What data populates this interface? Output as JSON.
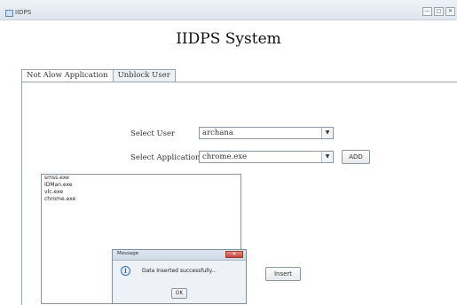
{
  "window": {
    "title": "IIDPS",
    "controls": [
      "—",
      "□",
      "✕"
    ]
  },
  "header": {
    "title": "IIDPS System"
  },
  "tabs": [
    {
      "label": "Not Alow Application",
      "active": true
    },
    {
      "label": "Unblock User",
      "active": false
    }
  ],
  "form": {
    "select_user_label": "Select User",
    "select_user_value": "archana",
    "select_app_label": "Select Application",
    "select_app_value": "chrome.exe",
    "add_button": "ADD",
    "insert_button": "Insert"
  },
  "app_list": [
    "smss.exe",
    "IDMan.exe",
    "vlc.exe",
    "chrome.exe"
  ],
  "dialog": {
    "title": "Message",
    "close": "✕",
    "icon": "info-icon",
    "message": "Data Inserted successfully...",
    "ok": "OK"
  }
}
